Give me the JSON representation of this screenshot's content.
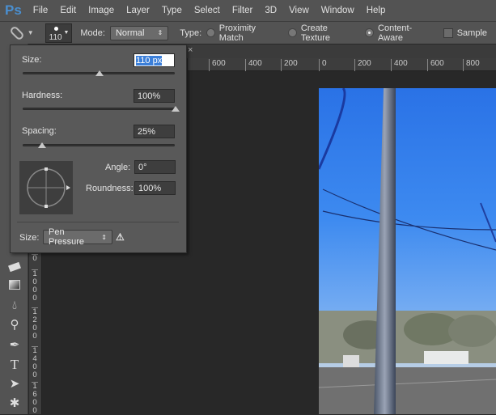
{
  "app": {
    "logo": "Ps"
  },
  "menu": [
    "File",
    "Edit",
    "Image",
    "Layer",
    "Type",
    "Select",
    "Filter",
    "3D",
    "View",
    "Window",
    "Help"
  ],
  "options": {
    "brush_size": "110",
    "mode_label": "Mode:",
    "mode_value": "Normal",
    "type_label": "Type:",
    "types": [
      {
        "label": "Proximity Match",
        "selected": false
      },
      {
        "label": "Create Texture",
        "selected": false
      },
      {
        "label": "Content-Aware",
        "selected": true
      }
    ],
    "sample_label": "Sample"
  },
  "popup": {
    "size_label": "Size:",
    "size_value": "110 px",
    "size_fraction": 0.5,
    "hardness_label": "Hardness:",
    "hardness_value": "100%",
    "hardness_fraction": 1.0,
    "spacing_label": "Spacing:",
    "spacing_value": "25%",
    "spacing_fraction": 0.12,
    "angle_label": "Angle:",
    "angle_value": "0°",
    "roundness_label": "Roundness:",
    "roundness_value": "100%",
    "size_control_label": "Size:",
    "size_control_value": "Pen Pressure"
  },
  "hruler": [
    "600",
    "400",
    "200",
    "0",
    "200",
    "400",
    "600",
    "800"
  ],
  "vruler": [
    "0",
    "1\n0\n0\n0",
    "1\n2\n0\n0",
    "1\n4\n0\n0",
    "1\n6\n0\n0"
  ],
  "tools": [
    "eraser-icon",
    "gradient-icon",
    "blur-icon",
    "dodge-icon",
    "pen-icon",
    "type-icon",
    "path-selection-icon",
    "shape-icon"
  ],
  "colors": {
    "ui": "#535353",
    "accent": "#4a8fd0",
    "selection": "#3b7fd9"
  }
}
